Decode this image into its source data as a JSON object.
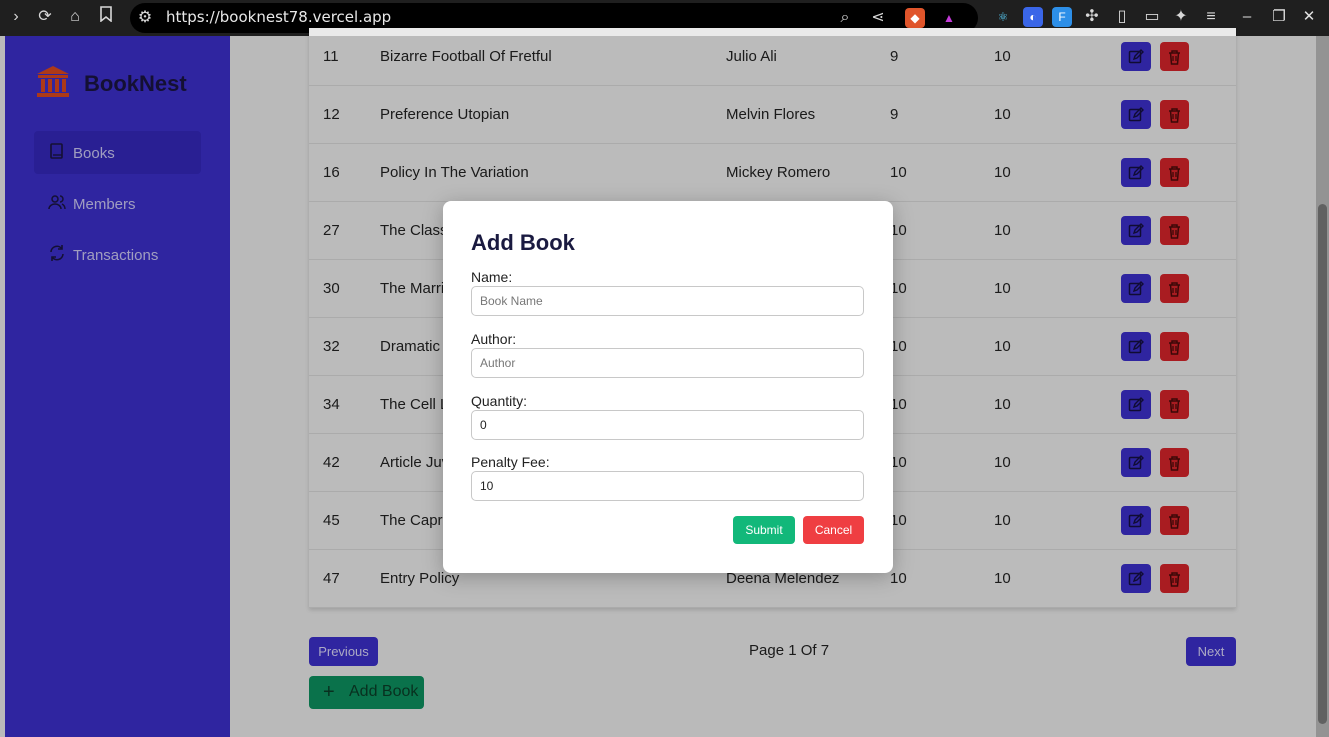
{
  "browser": {
    "url": "https://booknest78.vercel.app"
  },
  "sidebar": {
    "brand": "BookNest",
    "items": [
      {
        "label": "Books",
        "icon": "book-icon"
      },
      {
        "label": "Members",
        "icon": "users-icon"
      },
      {
        "label": "Transactions",
        "icon": "refresh-icon"
      }
    ]
  },
  "table": {
    "rows": [
      {
        "id": "11",
        "name": "Bizarre Football Of Fretful",
        "author": "Julio Ali",
        "quantity": "9",
        "fee": "10"
      },
      {
        "id": "12",
        "name": "Preference Utopian",
        "author": "Melvin Flores",
        "quantity": "9",
        "fee": "10"
      },
      {
        "id": "16",
        "name": "Policy In The Variation",
        "author": "Mickey Romero",
        "quantity": "10",
        "fee": "10"
      },
      {
        "id": "27",
        "name": "The Classr",
        "author": "",
        "quantity": "10",
        "fee": "10"
      },
      {
        "id": "30",
        "name": "The Marrie",
        "author": "",
        "quantity": "10",
        "fee": "10"
      },
      {
        "id": "32",
        "name": "Dramatic C",
        "author": "",
        "quantity": "10",
        "fee": "10"
      },
      {
        "id": "34",
        "name": "The Cell Lo",
        "author": "",
        "quantity": "10",
        "fee": "10"
      },
      {
        "id": "42",
        "name": "Article Juve",
        "author": "",
        "quantity": "10",
        "fee": "10"
      },
      {
        "id": "45",
        "name": "The Capric",
        "author": "",
        "quantity": "10",
        "fee": "10"
      },
      {
        "id": "47",
        "name": "Entry Policy",
        "author": "Deena Melendez",
        "quantity": "10",
        "fee": "10"
      }
    ]
  },
  "pagination": {
    "previous": "Previous",
    "page_info": "Page 1 Of 7",
    "next": "Next"
  },
  "add_book_button": "Add Book",
  "modal": {
    "title": "Add Book",
    "fields": {
      "name": {
        "label": "Name:",
        "placeholder": "Book Name",
        "value": ""
      },
      "author": {
        "label": "Author:",
        "placeholder": "Author",
        "value": ""
      },
      "quantity": {
        "label": "Quantity:",
        "value": "0"
      },
      "penalty": {
        "label": "Penalty Fee:",
        "value": "10"
      }
    },
    "submit": "Submit",
    "cancel": "Cancel"
  },
  "colors": {
    "sidebar": "#3b2fc9",
    "primary": "#3b2fc9",
    "danger": "#d4242a",
    "success": "#12b87a"
  }
}
